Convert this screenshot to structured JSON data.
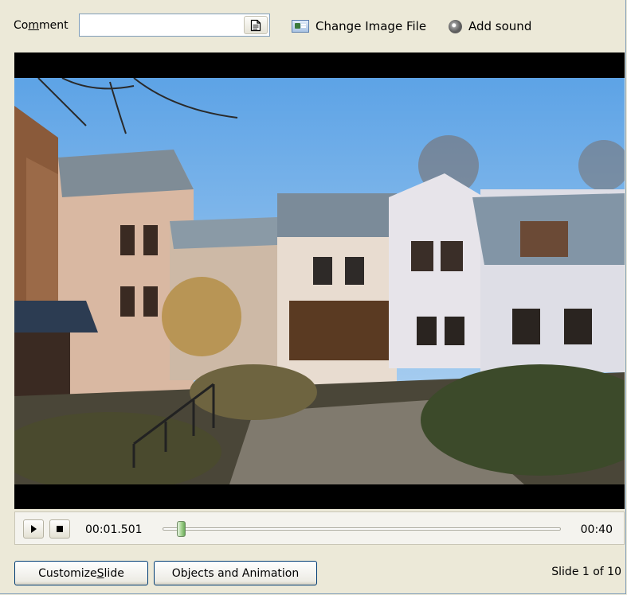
{
  "toolbar": {
    "comment_label_pre": "Co",
    "comment_label_key": "m",
    "comment_label_post": "ment",
    "comment_value": "",
    "note_icon": "note-icon",
    "change_image_label": "Change Image File",
    "change_image_icon": "image-icon",
    "add_sound_label": "Add sound",
    "add_sound_icon": "speaker-icon"
  },
  "preview": {
    "image": "photo of old buildings in a courtyard"
  },
  "playback": {
    "current_time": "00:01.501",
    "total_time": "00:40",
    "position_fraction": 0.0375
  },
  "footer": {
    "customize_pre": "Customize ",
    "customize_key": "S",
    "customize_post": "lide",
    "objects_label": "Objects and Animation",
    "slide_info": "Slide 1 of 10"
  }
}
